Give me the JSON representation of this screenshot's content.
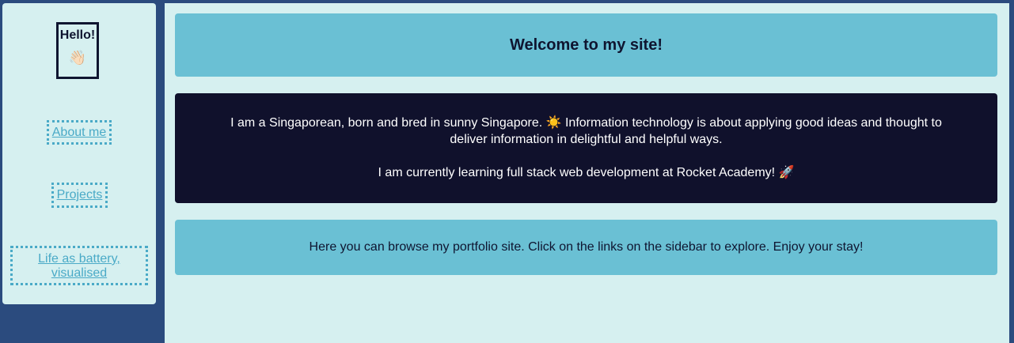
{
  "sidebar": {
    "greeting": "Hello!",
    "greeting_emoji": "👋🏻",
    "links": [
      {
        "label": "About me"
      },
      {
        "label": "Projects"
      },
      {
        "label": "Life as battery, visualised"
      }
    ]
  },
  "main": {
    "title": "Welcome to my site!",
    "about_paragraph_1": "I am a Singaporean, born and bred in sunny Singapore. ☀️ Information technology is about applying good ideas and thought to deliver information in delightful and helpful ways.",
    "about_paragraph_2": "I am currently learning full stack web development at Rocket Academy! 🚀",
    "intro": "Here you can browse my portfolio site. Click on the links on the sidebar to explore. Enjoy your stay!"
  },
  "colors": {
    "page_background": "#2b4b7e",
    "panel_background": "#d6f0f0",
    "accent": "#6ac0d4",
    "dark": "#10112c",
    "link": "#4aaac7"
  }
}
